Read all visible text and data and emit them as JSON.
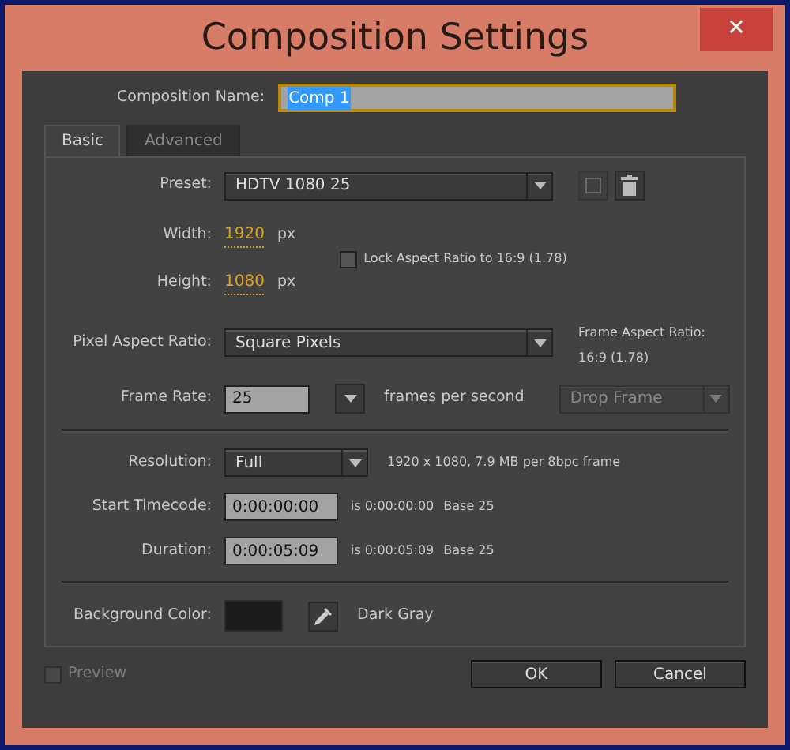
{
  "window": {
    "title": "Composition Settings",
    "close": "✕"
  },
  "composition_name": {
    "label": "Composition Name:",
    "value": "Comp 1"
  },
  "tabs": [
    {
      "label": "Basic",
      "selected": true
    },
    {
      "label": "Advanced",
      "selected": false
    }
  ],
  "preset": {
    "label": "Preset:",
    "value": "HDTV 1080 25"
  },
  "width": {
    "label": "Width:",
    "value": "1920",
    "unit": "px"
  },
  "height": {
    "label": "Height:",
    "value": "1080",
    "unit": "px"
  },
  "lock_aspect": {
    "label": "Lock Aspect Ratio to 16:9 (1.78)",
    "checked": false
  },
  "pixel_aspect_ratio": {
    "label": "Pixel Aspect Ratio:",
    "value": "Square Pixels"
  },
  "frame_aspect_ratio": {
    "label": "Frame Aspect Ratio:",
    "value": "16:9 (1.78)"
  },
  "frame_rate": {
    "label": "Frame Rate:",
    "value": "25",
    "unit": "frames per second"
  },
  "drop_frame": {
    "value": "Drop Frame",
    "disabled": true
  },
  "resolution": {
    "label": "Resolution:",
    "value": "Full",
    "info": "1920 x 1080, 7.9 MB per 8bpc frame"
  },
  "start_timecode": {
    "label": "Start Timecode:",
    "value": "0:00:00:00",
    "info": "is 0:00:00:00",
    "base": "Base 25"
  },
  "duration": {
    "label": "Duration:",
    "value": "0:00:05:09",
    "info": "is 0:00:05:09",
    "base": "Base 25"
  },
  "background_color": {
    "label": "Background Color:",
    "name": "Dark Gray"
  },
  "preview": {
    "label": "Preview",
    "checked": false,
    "disabled": true
  },
  "buttons": [
    "OK",
    "Cancel"
  ]
}
